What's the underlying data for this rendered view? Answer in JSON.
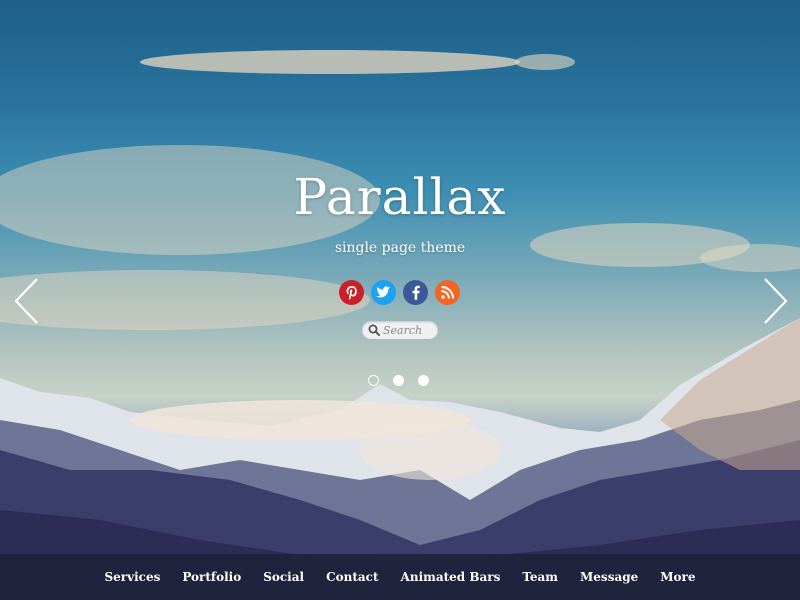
{
  "hero": {
    "title": "Parallax",
    "subtitle": "single page theme"
  },
  "social": [
    {
      "icon": "pinterest-icon",
      "glyph": "P",
      "color": "#cb2027"
    },
    {
      "icon": "twitter-icon",
      "glyph": "t",
      "color": "#1da1f2"
    },
    {
      "icon": "facebook-icon",
      "glyph": "f",
      "color": "#3b5998"
    },
    {
      "icon": "rss-icon",
      "glyph": "◉",
      "color": "#f26522"
    }
  ],
  "search": {
    "placeholder": "Search",
    "icon": "search-icon"
  },
  "slider": {
    "dots": 3,
    "active_index": 0,
    "prev_icon": "chevron-left-icon",
    "next_icon": "chevron-right-icon"
  },
  "nav": {
    "items": [
      "Services",
      "Portfolio",
      "Social",
      "Contact",
      "Animated Bars",
      "Team",
      "Message",
      "More"
    ]
  }
}
